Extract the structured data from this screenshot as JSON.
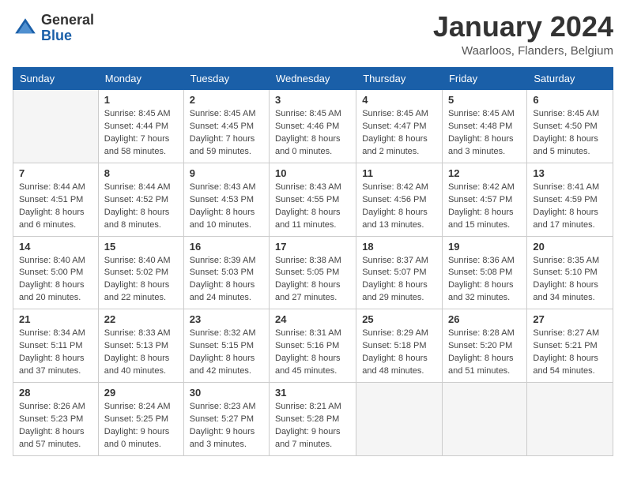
{
  "header": {
    "logo_general": "General",
    "logo_blue": "Blue",
    "month_year": "January 2024",
    "location": "Waarloos, Flanders, Belgium"
  },
  "days_of_week": [
    "Sunday",
    "Monday",
    "Tuesday",
    "Wednesday",
    "Thursday",
    "Friday",
    "Saturday"
  ],
  "weeks": [
    [
      {
        "day": "",
        "empty": true
      },
      {
        "day": "1",
        "sunrise": "8:45 AM",
        "sunset": "4:44 PM",
        "daylight": "7 hours and 58 minutes."
      },
      {
        "day": "2",
        "sunrise": "8:45 AM",
        "sunset": "4:45 PM",
        "daylight": "7 hours and 59 minutes."
      },
      {
        "day": "3",
        "sunrise": "8:45 AM",
        "sunset": "4:46 PM",
        "daylight": "8 hours and 0 minutes."
      },
      {
        "day": "4",
        "sunrise": "8:45 AM",
        "sunset": "4:47 PM",
        "daylight": "8 hours and 2 minutes."
      },
      {
        "day": "5",
        "sunrise": "8:45 AM",
        "sunset": "4:48 PM",
        "daylight": "8 hours and 3 minutes."
      },
      {
        "day": "6",
        "sunrise": "8:45 AM",
        "sunset": "4:50 PM",
        "daylight": "8 hours and 5 minutes."
      }
    ],
    [
      {
        "day": "7",
        "sunrise": "8:44 AM",
        "sunset": "4:51 PM",
        "daylight": "8 hours and 6 minutes."
      },
      {
        "day": "8",
        "sunrise": "8:44 AM",
        "sunset": "4:52 PM",
        "daylight": "8 hours and 8 minutes."
      },
      {
        "day": "9",
        "sunrise": "8:43 AM",
        "sunset": "4:53 PM",
        "daylight": "8 hours and 10 minutes."
      },
      {
        "day": "10",
        "sunrise": "8:43 AM",
        "sunset": "4:55 PM",
        "daylight": "8 hours and 11 minutes."
      },
      {
        "day": "11",
        "sunrise": "8:42 AM",
        "sunset": "4:56 PM",
        "daylight": "8 hours and 13 minutes."
      },
      {
        "day": "12",
        "sunrise": "8:42 AM",
        "sunset": "4:57 PM",
        "daylight": "8 hours and 15 minutes."
      },
      {
        "day": "13",
        "sunrise": "8:41 AM",
        "sunset": "4:59 PM",
        "daylight": "8 hours and 17 minutes."
      }
    ],
    [
      {
        "day": "14",
        "sunrise": "8:40 AM",
        "sunset": "5:00 PM",
        "daylight": "8 hours and 20 minutes."
      },
      {
        "day": "15",
        "sunrise": "8:40 AM",
        "sunset": "5:02 PM",
        "daylight": "8 hours and 22 minutes."
      },
      {
        "day": "16",
        "sunrise": "8:39 AM",
        "sunset": "5:03 PM",
        "daylight": "8 hours and 24 minutes."
      },
      {
        "day": "17",
        "sunrise": "8:38 AM",
        "sunset": "5:05 PM",
        "daylight": "8 hours and 27 minutes."
      },
      {
        "day": "18",
        "sunrise": "8:37 AM",
        "sunset": "5:07 PM",
        "daylight": "8 hours and 29 minutes."
      },
      {
        "day": "19",
        "sunrise": "8:36 AM",
        "sunset": "5:08 PM",
        "daylight": "8 hours and 32 minutes."
      },
      {
        "day": "20",
        "sunrise": "8:35 AM",
        "sunset": "5:10 PM",
        "daylight": "8 hours and 34 minutes."
      }
    ],
    [
      {
        "day": "21",
        "sunrise": "8:34 AM",
        "sunset": "5:11 PM",
        "daylight": "8 hours and 37 minutes."
      },
      {
        "day": "22",
        "sunrise": "8:33 AM",
        "sunset": "5:13 PM",
        "daylight": "8 hours and 40 minutes."
      },
      {
        "day": "23",
        "sunrise": "8:32 AM",
        "sunset": "5:15 PM",
        "daylight": "8 hours and 42 minutes."
      },
      {
        "day": "24",
        "sunrise": "8:31 AM",
        "sunset": "5:16 PM",
        "daylight": "8 hours and 45 minutes."
      },
      {
        "day": "25",
        "sunrise": "8:29 AM",
        "sunset": "5:18 PM",
        "daylight": "8 hours and 48 minutes."
      },
      {
        "day": "26",
        "sunrise": "8:28 AM",
        "sunset": "5:20 PM",
        "daylight": "8 hours and 51 minutes."
      },
      {
        "day": "27",
        "sunrise": "8:27 AM",
        "sunset": "5:21 PM",
        "daylight": "8 hours and 54 minutes."
      }
    ],
    [
      {
        "day": "28",
        "sunrise": "8:26 AM",
        "sunset": "5:23 PM",
        "daylight": "8 hours and 57 minutes."
      },
      {
        "day": "29",
        "sunrise": "8:24 AM",
        "sunset": "5:25 PM",
        "daylight": "9 hours and 0 minutes."
      },
      {
        "day": "30",
        "sunrise": "8:23 AM",
        "sunset": "5:27 PM",
        "daylight": "9 hours and 3 minutes."
      },
      {
        "day": "31",
        "sunrise": "8:21 AM",
        "sunset": "5:28 PM",
        "daylight": "9 hours and 7 minutes."
      },
      {
        "day": "",
        "empty": true
      },
      {
        "day": "",
        "empty": true
      },
      {
        "day": "",
        "empty": true
      }
    ]
  ]
}
